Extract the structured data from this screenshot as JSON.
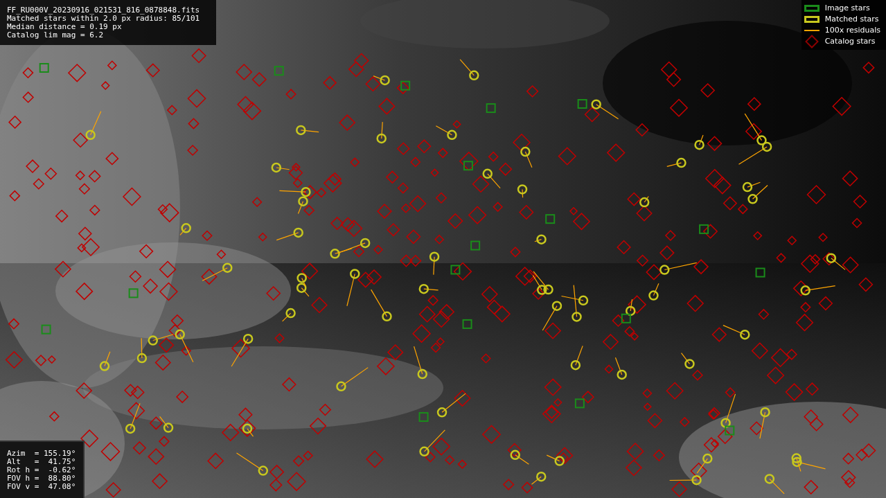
{
  "info_panel": {
    "lines": [
      "FF_RU000V_20230916_021531_816_0878848.fits",
      "Matched stars within 2.0 px radius: 85/101",
      "Median distance = 0.19 px",
      "Catalog lim mag = 6.2"
    ]
  },
  "legend": [
    {
      "kind": "box",
      "label": "Image stars",
      "color": "#1a8c1a"
    },
    {
      "kind": "box",
      "label": "Matched stars",
      "color": "#c8c81e"
    },
    {
      "kind": "line",
      "label": "100x residuals",
      "color": "#ffa500"
    },
    {
      "kind": "diamond",
      "label": "Catalog stars",
      "color": "#8c0000"
    }
  ],
  "pointing_panel": {
    "lines": [
      "Azim  = 155.19°",
      "Alt   =  41.75°",
      "Rot h =  -0.62°",
      "FOV h =  88.80°",
      "FOV v =  47.08°"
    ]
  }
}
